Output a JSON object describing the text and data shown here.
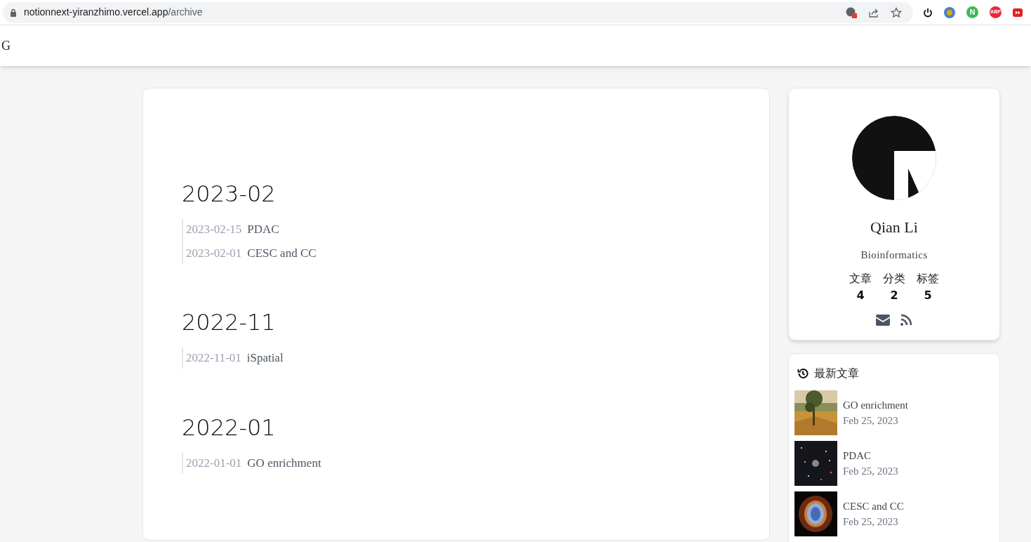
{
  "browser": {
    "url_host": "notionnext-yiranzhimo.vercel.app",
    "url_path": "/archive",
    "extensions": [
      {
        "kind": "power"
      },
      {
        "kind": "dot"
      },
      {
        "kind": "letter",
        "label": "N",
        "color": "#3cba54"
      },
      {
        "kind": "letter",
        "label": "ABP",
        "color": "#e8263c"
      },
      {
        "kind": "forward"
      }
    ]
  },
  "nav": {
    "logo": "G"
  },
  "archive": [
    {
      "month": "2023-02",
      "posts": [
        {
          "date": "2023-02-15",
          "title": "PDAC"
        },
        {
          "date": "2023-02-01",
          "title": "CESC and CC"
        }
      ]
    },
    {
      "month": "2022-11",
      "posts": [
        {
          "date": "2022-11-01",
          "title": "iSpatial"
        }
      ]
    },
    {
      "month": "2022-01",
      "posts": [
        {
          "date": "2022-01-01",
          "title": "GO enrichment"
        }
      ]
    }
  ],
  "profile": {
    "name": "Qian Li",
    "bio": "Bioinformatics",
    "stats": [
      {
        "label": "文章",
        "count": "4"
      },
      {
        "label": "分类",
        "count": "2"
      },
      {
        "label": "标签",
        "count": "5"
      }
    ]
  },
  "recent": {
    "title": "最新文章",
    "posts": [
      {
        "title": "GO enrichment",
        "date": "Feb 25, 2023"
      },
      {
        "title": "PDAC",
        "date": "Feb 25, 2023"
      },
      {
        "title": "CESC and CC",
        "date": "Feb 25, 2023"
      }
    ]
  }
}
